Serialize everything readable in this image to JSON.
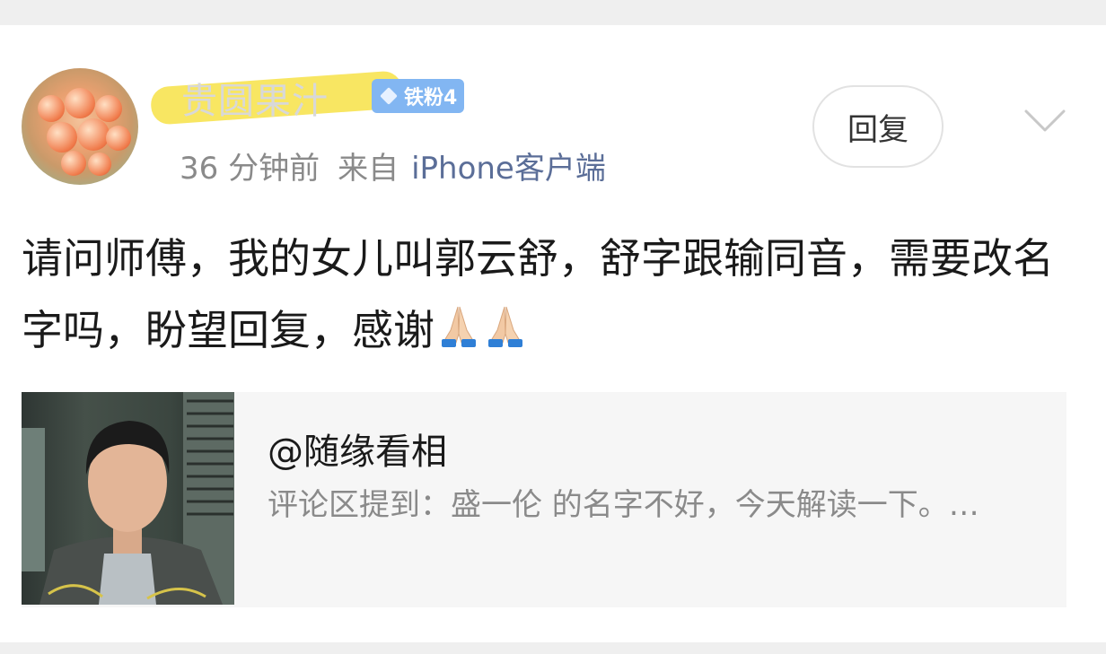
{
  "comment": {
    "username": "贵圆果汁",
    "badge": "铁粉4",
    "time": "36 分钟前",
    "from_label": "来自",
    "client": "iPhone客户端",
    "reply_label": "回复",
    "text": "请问师傅，我的女儿叫郭云舒，舒字跟输同音，需要改名字吗，盼望回复，感谢"
  },
  "quote": {
    "title": "@随缘看相",
    "description": "评论区提到：盛一伦 的名字不好，今天解读一下。…"
  },
  "icons": [
    "chevron-down-icon",
    "pray-emoji-icon",
    "badge-diamond-icon"
  ],
  "colors": {
    "background": "#efefef",
    "card": "#ffffff",
    "badge": "#82b6f2",
    "client_link": "#5b6e98",
    "highlight": "#f7e455",
    "meta_text": "#8a8a8a"
  }
}
